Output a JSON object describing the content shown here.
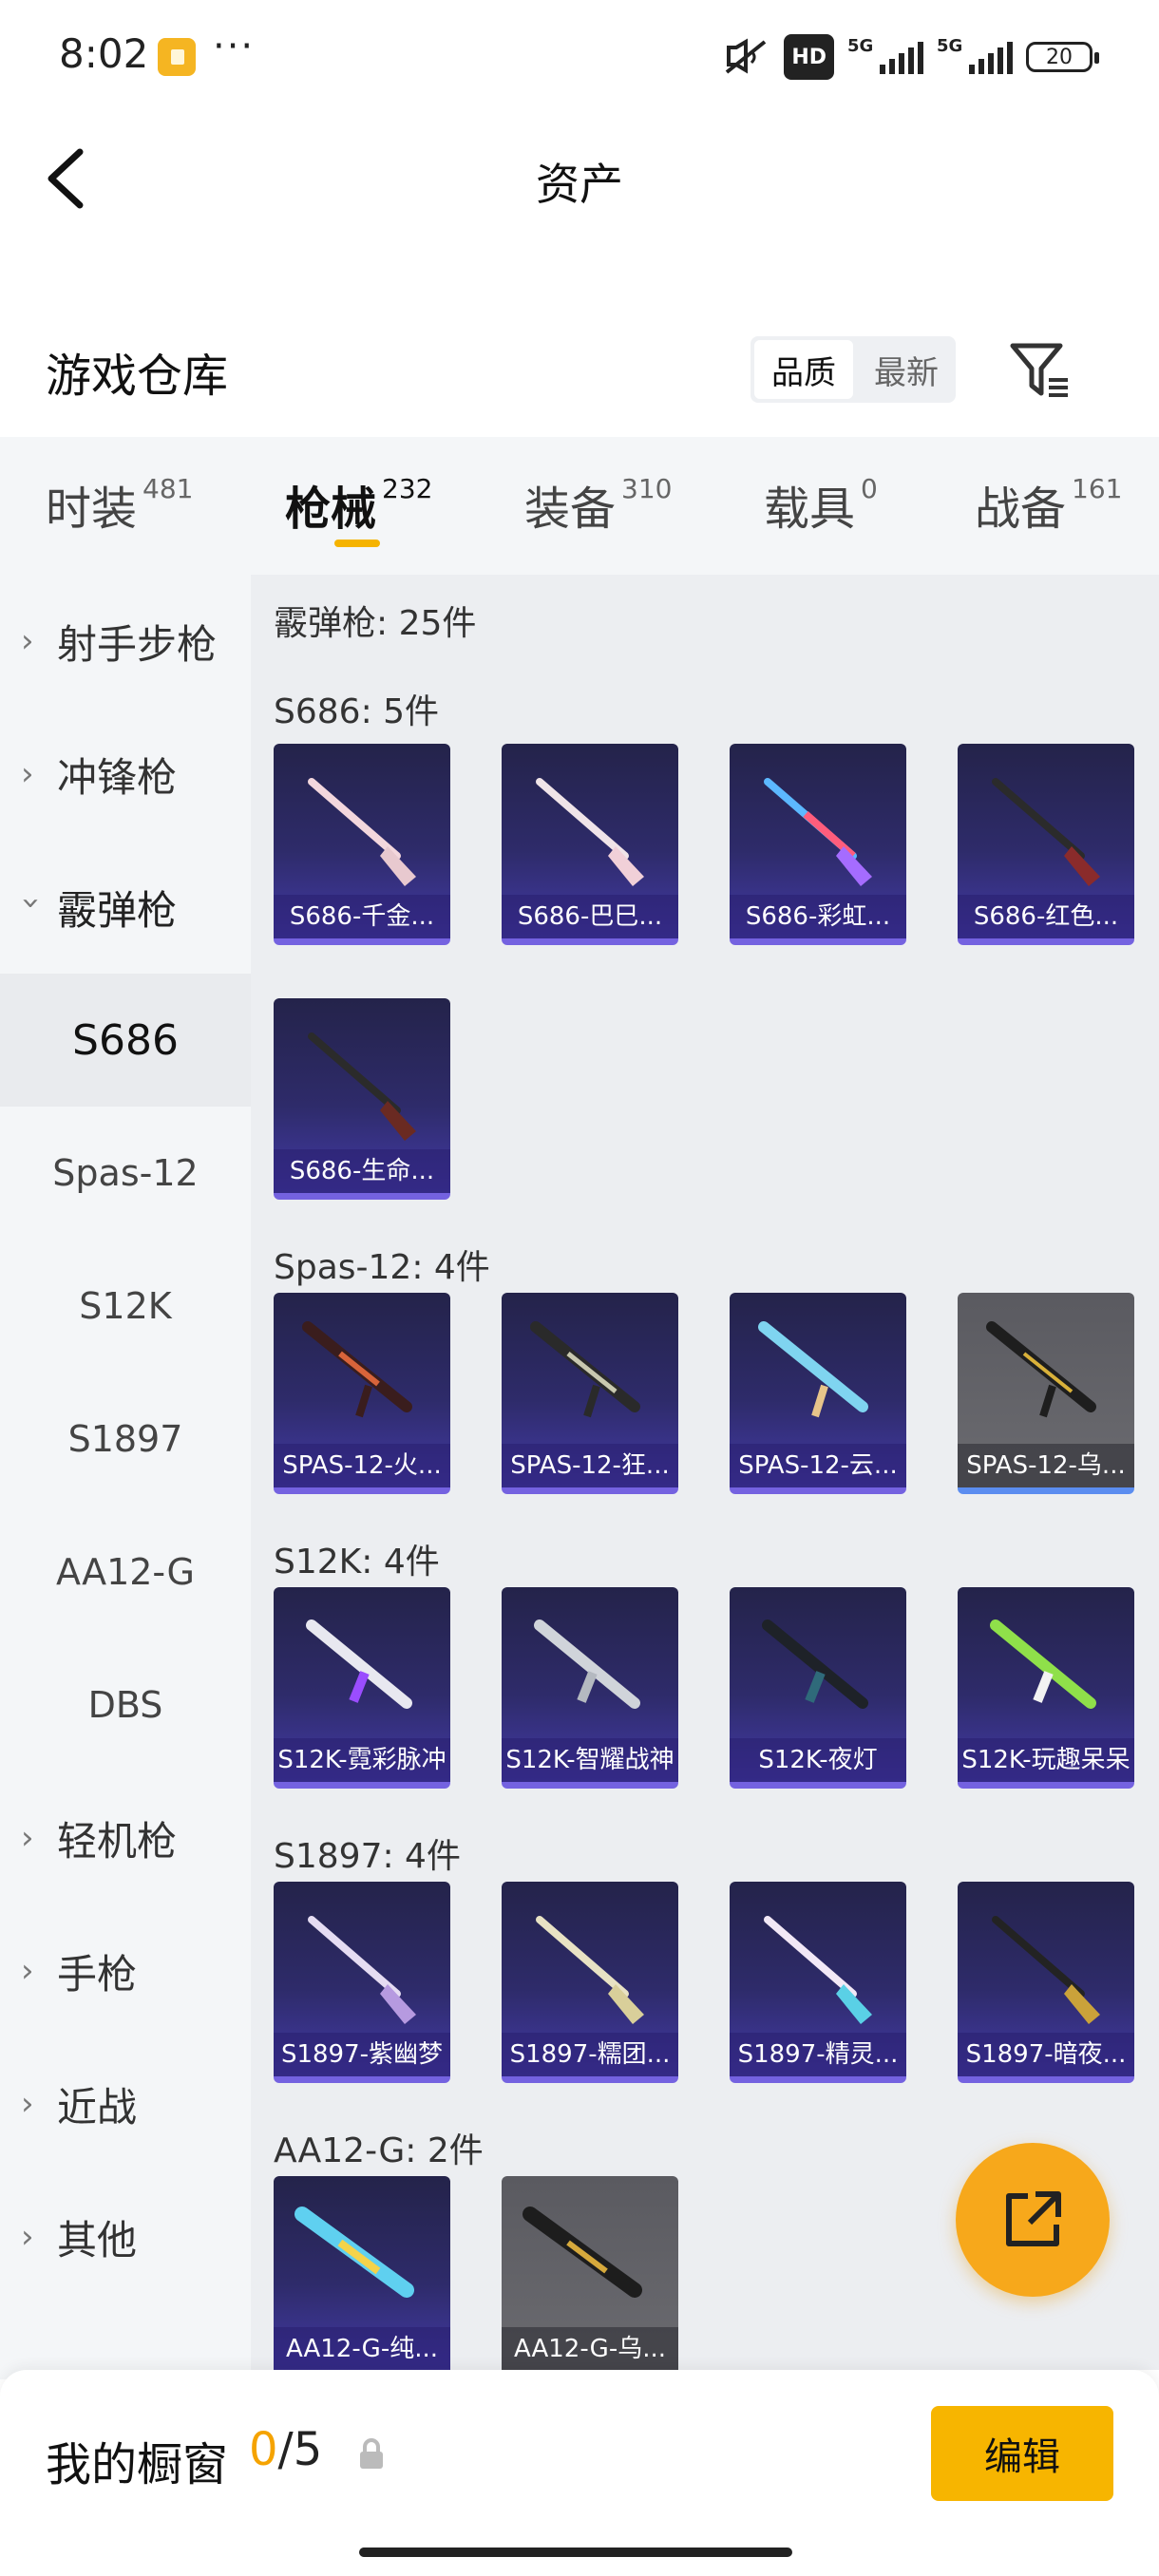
{
  "status_bar": {
    "time": "8:02",
    "dots": "···",
    "hd": "HD",
    "net1": "5G",
    "net2": "5G",
    "battery": "20"
  },
  "nav": {
    "title": "资产"
  },
  "warehouse": {
    "title": "游戏仓库",
    "sort_options": [
      "品质",
      "最新"
    ],
    "active_sort": "品质"
  },
  "category_tabs": [
    {
      "label": "时装",
      "count": "481"
    },
    {
      "label": "枪械",
      "count": "232"
    },
    {
      "label": "装备",
      "count": "310"
    },
    {
      "label": "载具",
      "count": "0"
    },
    {
      "label": "战备",
      "count": "161"
    }
  ],
  "sidebar": {
    "groups": [
      "射手步枪",
      "冲锋枪",
      "霰弹枪",
      "轻机枪",
      "手枪",
      "近战",
      "其他"
    ],
    "subitems": [
      "S686",
      "Spas-12",
      "S12K",
      "S1897",
      "AA12-G",
      "DBS"
    ]
  },
  "content": {
    "category_total": "霰弹枪: 25件",
    "sections": [
      {
        "label": "S686: 5件",
        "items": [
          "S686-千金...",
          "S686-巴巳...",
          "S686-彩虹...",
          "S686-红色...",
          "S686-生命..."
        ]
      },
      {
        "label": "Spas-12: 4件",
        "items": [
          "SPAS-12-火...",
          "SPAS-12-狂...",
          "SPAS-12-云...",
          "SPAS-12-乌..."
        ]
      },
      {
        "label": "S12K: 4件",
        "items": [
          "S12K-霓彩脉冲",
          "S12K-智耀战神",
          "S12K-夜灯",
          "S12K-玩趣呆呆"
        ]
      },
      {
        "label": "S1897: 4件",
        "items": [
          "S1897-紫幽梦",
          "S1897-糯团...",
          "S1897-精灵...",
          "S1897-暗夜..."
        ]
      },
      {
        "label": "AA12-G: 2件",
        "items": [
          "AA12-G-纯...",
          "AA12-G-乌..."
        ]
      }
    ]
  },
  "bottom_bar": {
    "label": "我的橱窗",
    "current": "0",
    "total": "/5",
    "edit_label": "编辑"
  },
  "colors": {
    "accent": "#f7b500",
    "card_top": "#24234a",
    "card_bottom": "#433aa6",
    "card_border": "#7462e0"
  }
}
